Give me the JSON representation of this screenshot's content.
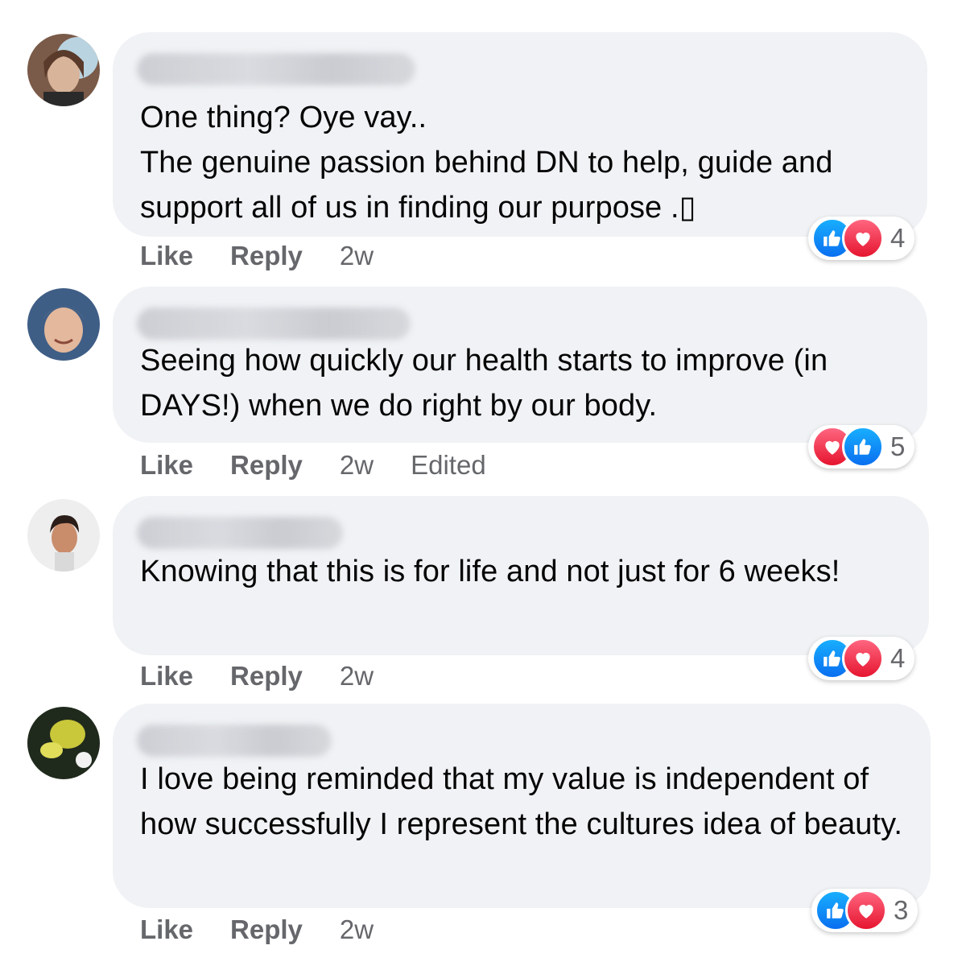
{
  "comments": [
    {
      "text": "One thing? Oye vay..\nThe genuine passion behind DN to help, guide and support all of us in finding our purpose .▯",
      "actions": {
        "like": "Like",
        "reply": "Reply",
        "time": "2w",
        "edited": ""
      },
      "reactions": {
        "icons": [
          "like-icon",
          "love-icon"
        ],
        "count": "4"
      }
    },
    {
      "text": "Seeing how quickly our health starts to improve (in DAYS!) when we do right by our body.",
      "actions": {
        "like": "Like",
        "reply": "Reply",
        "time": "2w",
        "edited": "Edited"
      },
      "reactions": {
        "icons": [
          "love-icon",
          "like-icon"
        ],
        "count": "5"
      }
    },
    {
      "text": "Knowing that this is for life and not just for 6 weeks!",
      "actions": {
        "like": "Like",
        "reply": "Reply",
        "time": "2w",
        "edited": ""
      },
      "reactions": {
        "icons": [
          "like-icon",
          "love-icon"
        ],
        "count": "4"
      }
    },
    {
      "text": "I love being reminded that my value is independent of how successfully I represent the cultures idea of beauty.",
      "actions": {
        "like": "Like",
        "reply": "Reply",
        "time": "2w",
        "edited": ""
      },
      "reactions": {
        "icons": [
          "like-icon",
          "love-icon"
        ],
        "count": "3"
      }
    }
  ],
  "colors": {
    "bubble": "#f0f2f5",
    "secondary_text": "#65676b",
    "like_blue": "#0a6ff0",
    "love_red": "#e6152f"
  }
}
